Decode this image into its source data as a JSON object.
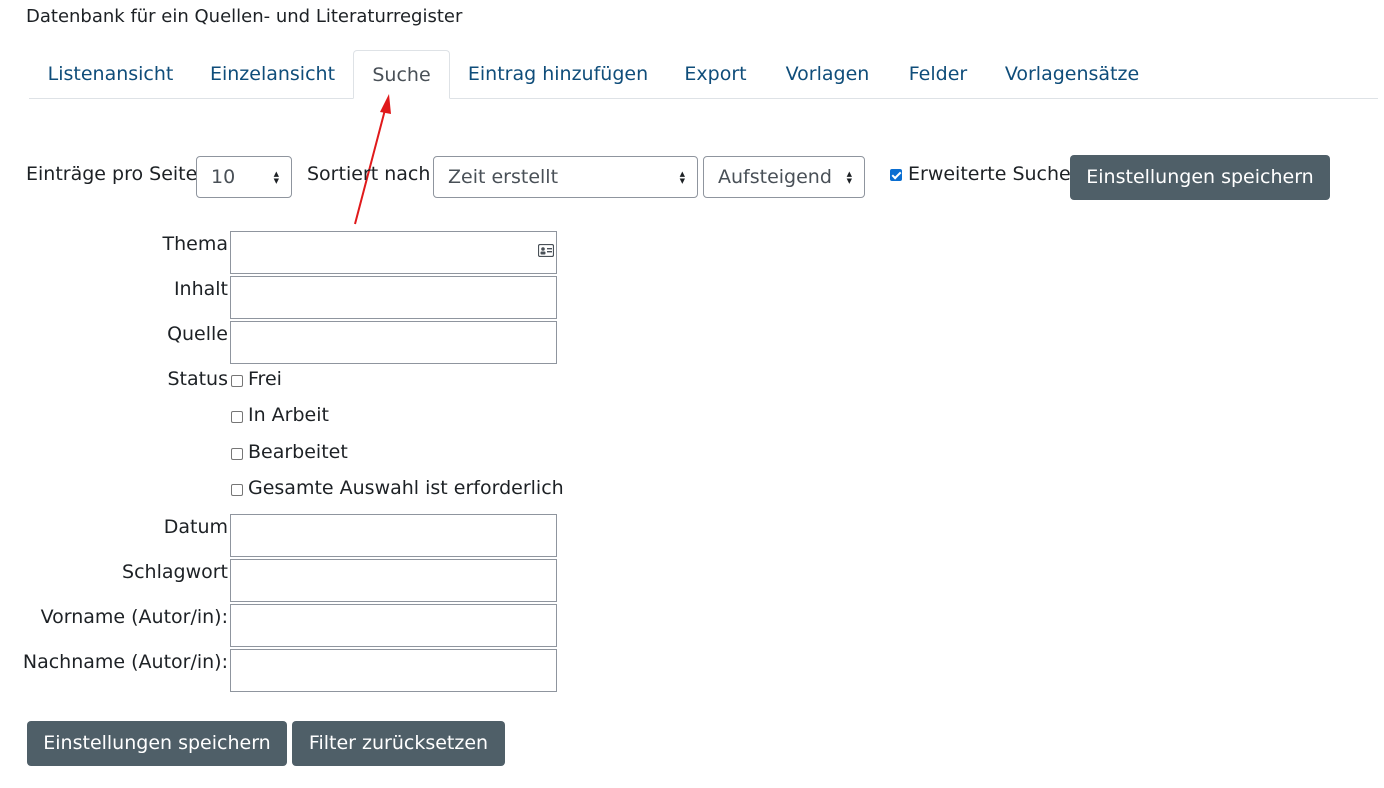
{
  "page_title": "Datenbank für ein Quellen- und Literaturregister",
  "tabs": [
    {
      "label": "Listenansicht"
    },
    {
      "label": "Einzelansicht"
    },
    {
      "label": "Suche"
    },
    {
      "label": "Eintrag hinzufügen"
    },
    {
      "label": "Export"
    },
    {
      "label": "Vorlagen"
    },
    {
      "label": "Felder"
    },
    {
      "label": "Vorlagensätze"
    }
  ],
  "active_tab": "Suche",
  "toolbar": {
    "per_page_label": "Einträge pro Seite",
    "per_page_value": "10",
    "sort_label": "Sortiert nach",
    "sort_value": "Zeit erstellt",
    "order_value": "Aufsteigend",
    "advanced_search_label": "Erweiterte Suche",
    "advanced_search_checked": true,
    "save_label": "Einstellungen speichern"
  },
  "fields": {
    "thema": {
      "label": "Thema",
      "value": ""
    },
    "inhalt": {
      "label": "Inhalt",
      "value": ""
    },
    "quelle": {
      "label": "Quelle",
      "value": ""
    },
    "status": {
      "label": "Status",
      "options": [
        {
          "label": "Frei",
          "checked": false
        },
        {
          "label": "In Arbeit",
          "checked": false
        },
        {
          "label": "Bearbeitet",
          "checked": false
        },
        {
          "label": "Gesamte Auswahl ist erforderlich",
          "checked": false
        }
      ]
    },
    "datum": {
      "label": "Datum",
      "value": ""
    },
    "schlagwort": {
      "label": "Schlagwort",
      "value": ""
    },
    "vorname": {
      "label": "Vorname (Autor/in):",
      "value": ""
    },
    "nachname": {
      "label": "Nachname (Autor/in):",
      "value": ""
    }
  },
  "footer": {
    "save_label": "Einstellungen speichern",
    "reset_label": "Filter zurücksetzen"
  },
  "colors": {
    "link": "#0f4d7a",
    "button": "#4f5f68",
    "annotation_arrow": "#e0191b",
    "checkbox_checked": "#0a6ed1"
  },
  "icons": {
    "thema_input": "address-card-icon",
    "select_caret": "sort-caret-icon"
  }
}
